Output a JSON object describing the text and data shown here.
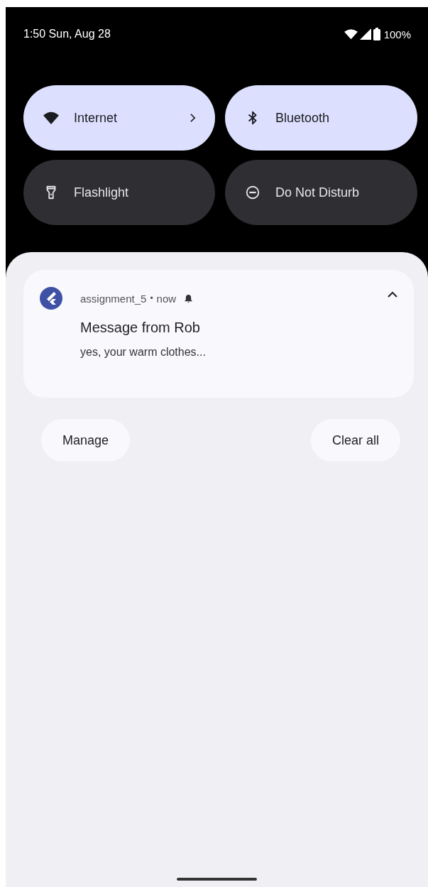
{
  "status_bar": {
    "clock": "1:50 Sun, Aug 28",
    "battery": "100%"
  },
  "tiles": [
    {
      "label": "Internet",
      "kind": "wifi",
      "on": true,
      "chevron": true
    },
    {
      "label": "Bluetooth",
      "kind": "bluetooth",
      "on": true,
      "chevron": false
    },
    {
      "label": "Flashlight",
      "kind": "flashlight",
      "on": false,
      "chevron": false
    },
    {
      "label": "Do Not Disturb",
      "kind": "dnd",
      "on": false,
      "chevron": false
    }
  ],
  "notification": {
    "app": "assignment_5",
    "separator": "•",
    "time": "now",
    "expanded": true,
    "title": "Message from Rob",
    "text": "yes, your warm clothes..."
  },
  "buttons": [
    "Manage",
    "Clear all"
  ]
}
